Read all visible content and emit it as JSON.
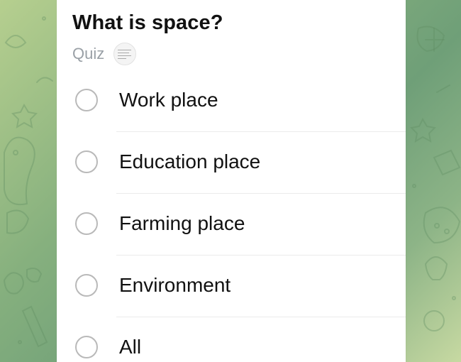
{
  "poll": {
    "question": "What is space?",
    "type_label": "Quiz",
    "options": [
      {
        "label": "Work place"
      },
      {
        "label": "Education place"
      },
      {
        "label": "Farming place"
      },
      {
        "label": "Environment"
      },
      {
        "label": "All"
      }
    ]
  },
  "colors": {
    "card_background": "#ffffff",
    "radio_border": "#b9b9b9",
    "muted_text": "#9aa0a6",
    "chat_background": "#86b07e"
  },
  "icons": {
    "avatar": "quiz-creator-avatar",
    "background": "chat-doodle-wallpaper"
  }
}
